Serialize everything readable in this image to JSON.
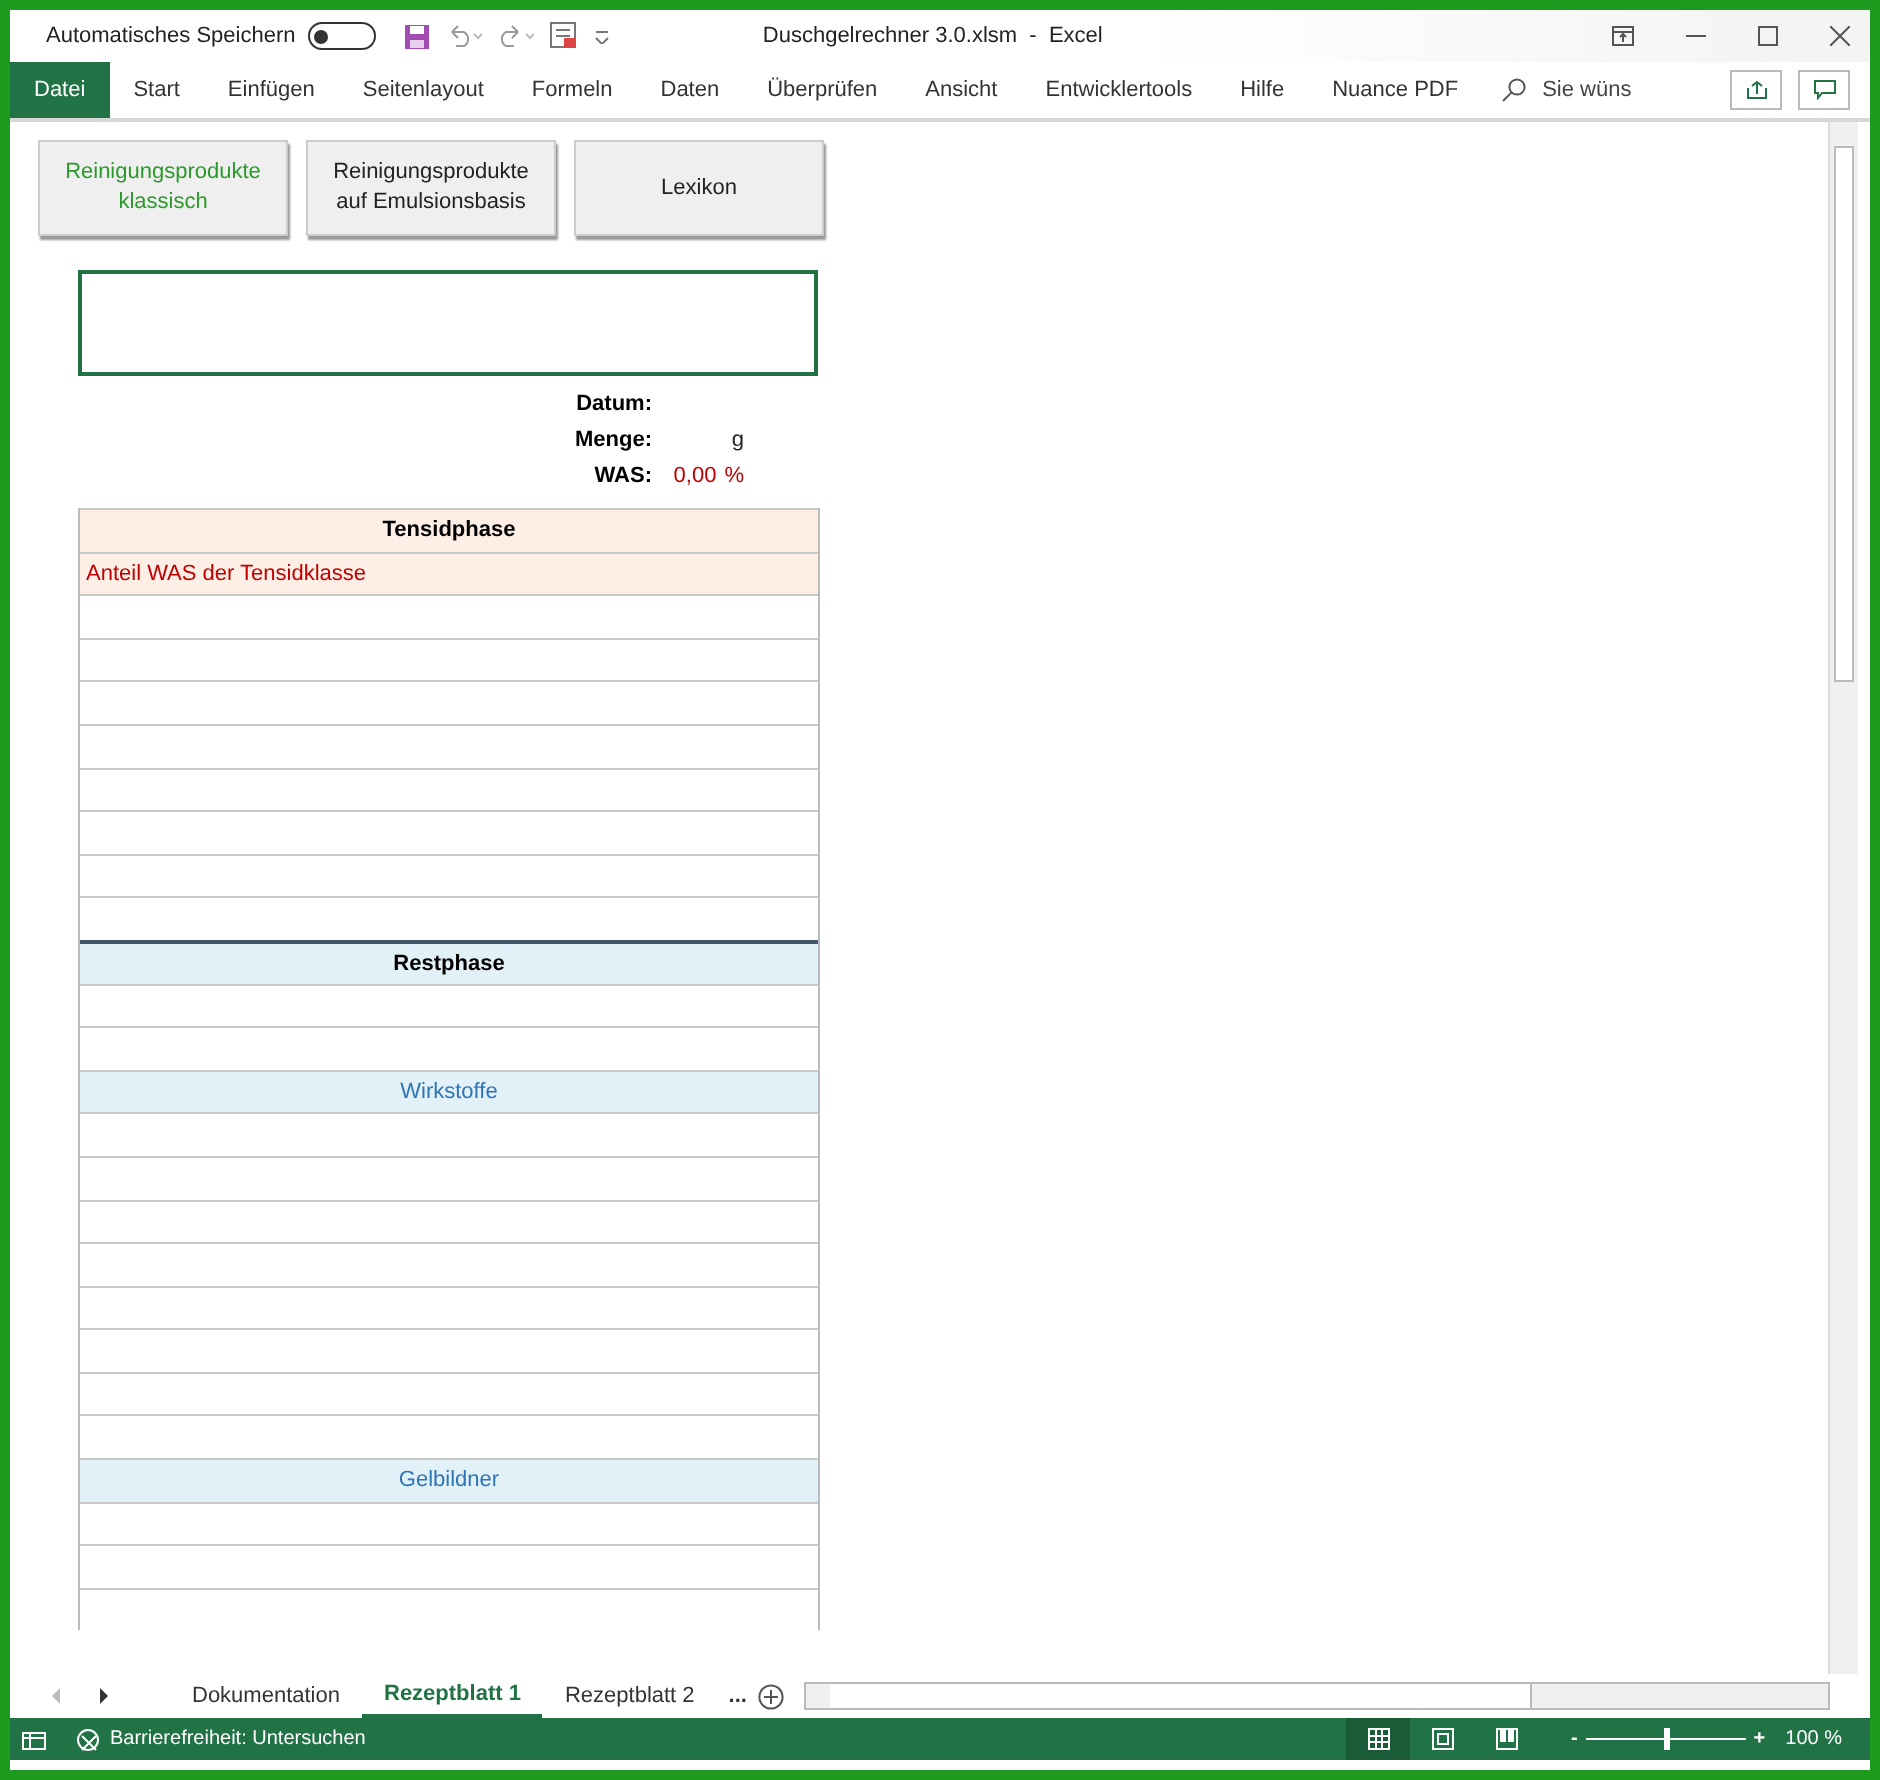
{
  "title_bar": {
    "autosave_label": "Automatisches Speichern",
    "autosave_on": false,
    "title": "Duschgelrechner 3.0.xlsm  -  Excel"
  },
  "ribbon_tabs": [
    {
      "label": "Datei",
      "selected": true
    },
    {
      "label": "Start",
      "selected": false
    },
    {
      "label": "Einfügen",
      "selected": false
    },
    {
      "label": "Seitenlayout",
      "selected": false
    },
    {
      "label": "Formeln",
      "selected": false
    },
    {
      "label": "Daten",
      "selected": false
    },
    {
      "label": "Überprüfen",
      "selected": false
    },
    {
      "label": "Ansicht",
      "selected": false
    },
    {
      "label": "Entwicklertools",
      "selected": false
    },
    {
      "label": "Hilfe",
      "selected": false
    },
    {
      "label": "Nuance PDF",
      "selected": false
    }
  ],
  "search": {
    "placeholder": "Sie wüns"
  },
  "sheet": {
    "buttons": [
      {
        "lines": [
          "Reinigungsprodukte",
          "klassisch"
        ],
        "selected": true
      },
      {
        "lines": [
          "Reinigungsprodukte",
          "auf Emulsionsbasis"
        ],
        "selected": false
      },
      {
        "lines": [
          "Lexikon"
        ],
        "selected": false
      }
    ],
    "fields": [
      {
        "label": "Datum:"
      },
      {
        "label": "Menge:",
        "unit": "g"
      },
      {
        "label": "WAS:",
        "value": "0,00",
        "unit": "%"
      }
    ],
    "rows": [
      {
        "kind": "section",
        "color": "#fdefe5",
        "text": "Tensidphase"
      },
      {
        "kind": "note",
        "color": "#fdefe5",
        "text": "Anteil WAS der Tensidklasse"
      },
      {
        "kind": "empty"
      },
      {
        "kind": "empty"
      },
      {
        "kind": "empty"
      },
      {
        "kind": "empty"
      },
      {
        "kind": "empty"
      },
      {
        "kind": "empty"
      },
      {
        "kind": "empty"
      },
      {
        "kind": "empty"
      },
      {
        "kind": "section",
        "color": "#e2f0f7",
        "text": "Restphase"
      },
      {
        "kind": "empty"
      },
      {
        "kind": "empty"
      },
      {
        "kind": "subsection",
        "color": "#e2f0f7",
        "text": "Wirkstoffe"
      },
      {
        "kind": "empty"
      },
      {
        "kind": "empty"
      },
      {
        "kind": "empty"
      },
      {
        "kind": "empty"
      },
      {
        "kind": "empty"
      },
      {
        "kind": "empty"
      },
      {
        "kind": "empty"
      },
      {
        "kind": "empty"
      },
      {
        "kind": "subsection",
        "color": "#e2f0f7",
        "text": "Gelbildner"
      },
      {
        "kind": "empty"
      },
      {
        "kind": "empty"
      },
      {
        "kind": "empty"
      }
    ]
  },
  "sheet_tabs": [
    {
      "label": "Dokumentation",
      "selected": false
    },
    {
      "label": "Rezeptblatt 1",
      "selected": true
    },
    {
      "label": "Rezeptblatt 2",
      "selected": false
    }
  ],
  "more_tabs": "...",
  "status_bar": {
    "accessibility": "Barrierefreiheit: Untersuchen",
    "views": [
      {
        "kind": "normal",
        "selected": true
      },
      {
        "kind": "layout",
        "selected": false
      },
      {
        "kind": "pagebreak",
        "selected": false
      }
    ],
    "zoom": {
      "minus": "-",
      "plus": "+",
      "level": 0.5,
      "reading": "100 %"
    }
  }
}
